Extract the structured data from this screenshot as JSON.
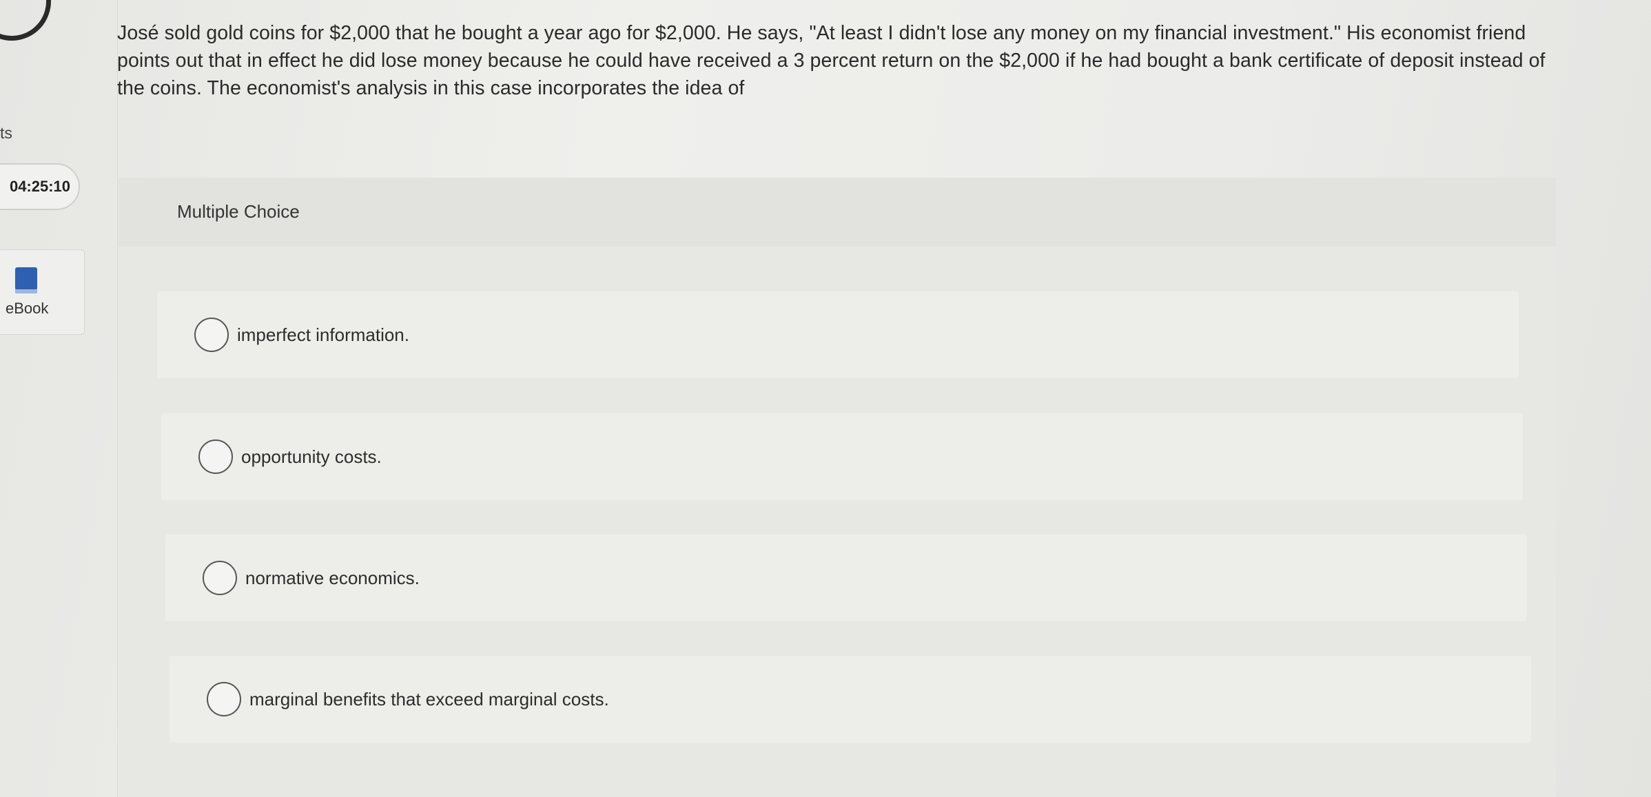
{
  "sidebar": {
    "points_label": "ts",
    "timer": "04:25:10",
    "ebook_label": "eBook"
  },
  "question": {
    "text": "José sold gold coins for $2,000 that he bought a year ago for $2,000. He says, \"At least I didn't lose any money on my financial investment.\" His economist friend points out that in effect he did lose money because he could have received a 3 percent return on the $2,000 if he had bought a bank certificate of deposit instead of the coins. The economist's analysis in this case incorporates the idea of"
  },
  "mc": {
    "title": "Multiple Choice",
    "options": [
      {
        "label": "imperfect information."
      },
      {
        "label": "opportunity costs."
      },
      {
        "label": "normative economics."
      },
      {
        "label": "marginal benefits that exceed marginal costs."
      }
    ]
  },
  "icons": {
    "progress": "progress-arc-icon",
    "ebook": "book-icon",
    "radio": "radio-unselected-icon"
  }
}
